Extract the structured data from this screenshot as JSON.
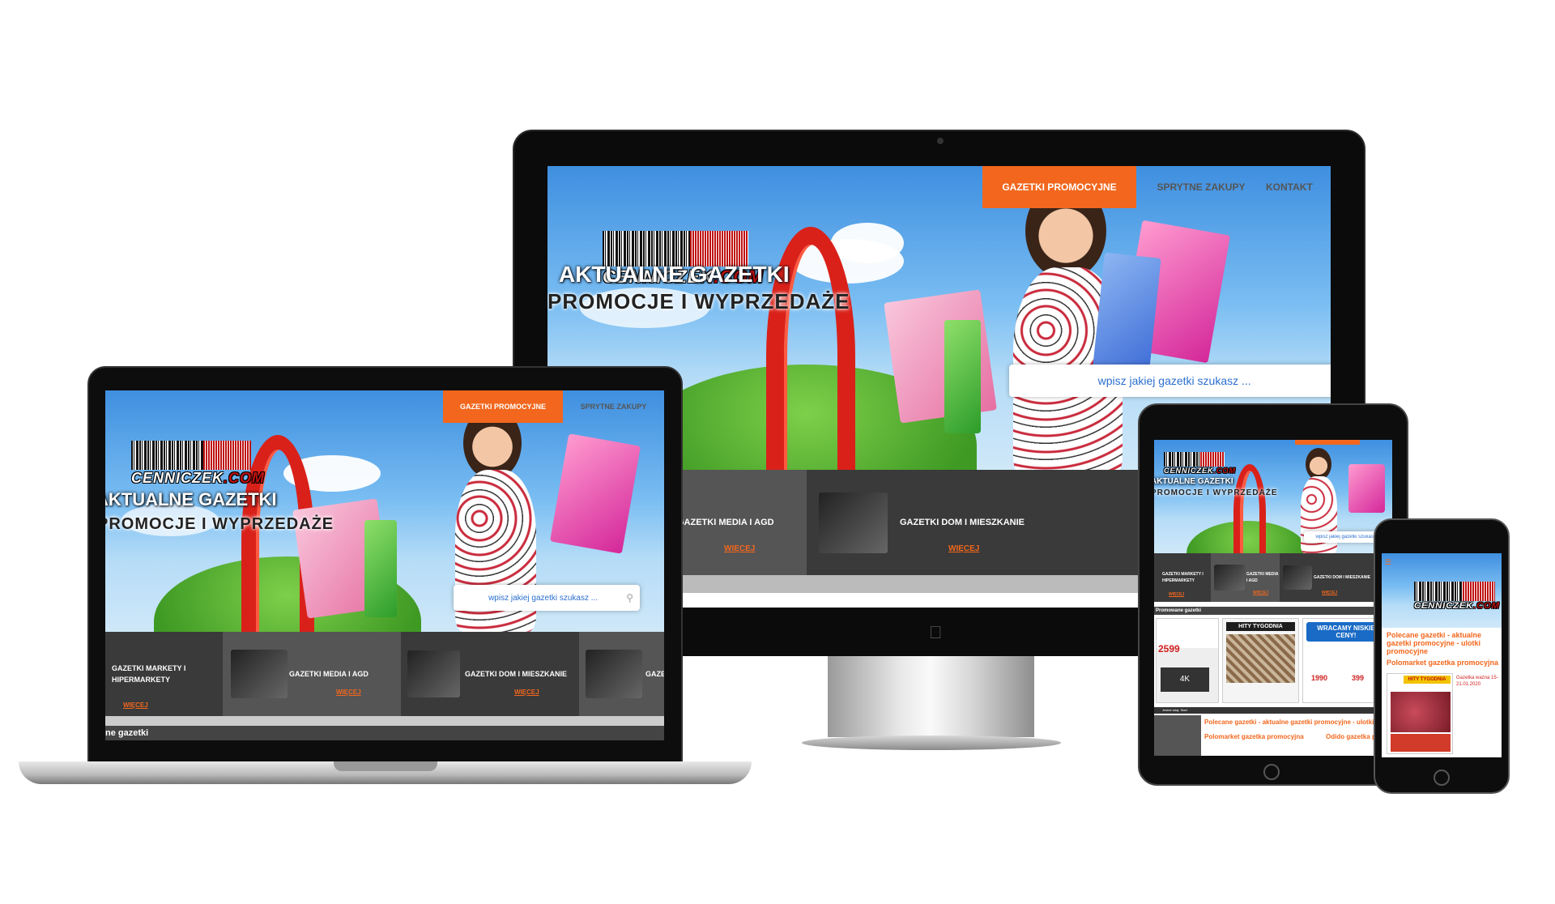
{
  "site": {
    "logo_brand": "CENNICZEK",
    "logo_tld": ".COM",
    "headline": "AKTUALNE GAZETKI",
    "subheadline": "PROMOCJE I WYPRZEDAŻE",
    "search_placeholder": "wpisz jakiej gazetki szukasz ...",
    "nav": [
      "GAZETKI PROMOCYJNE",
      "SPRYTNE ZAKUPY",
      "KONTAKT"
    ],
    "categories": [
      {
        "label": "GAZETKI MARKETY I HIPERMARKETY",
        "more": "Więcej",
        "icon": "shopping-bags-icon"
      },
      {
        "label": "GAZETKI MEDIA I AGD",
        "more": "Więcej",
        "icon": "tv-appliances-icon"
      },
      {
        "label": "GAZETKI DOM I MIESZKANIE",
        "more": "Więcej",
        "icon": "drill-tools-icon"
      },
      {
        "label": "GAZETKI SPORT",
        "more": "Więcej",
        "icon": "bike-sport-icon"
      }
    ],
    "section_title": "Promowane gazetki",
    "laptop_section_title": "ne gazetki",
    "tablet_section_title": "Promowane gazetki",
    "recommended": "Polecane gazetki - aktualne gazetki promocyjne - ulotki promocyjne",
    "flyer_titles": [
      "Polomarket gazetka promocyjna",
      "Odido gazetka promocyjna"
    ],
    "flyer_texts": [
      "HITY TYGODNIA",
      "WRACAMY NISKIE CENY!",
      "2599",
      "4K",
      "1990",
      "399"
    ],
    "flyer_caption": "Gazetka ważna 15-21.01.2020",
    "breadcrumb": "Jesteś tutaj: Start"
  },
  "colors": {
    "accent": "#f2671d",
    "sky_top": "#3f8fe0",
    "dark_band": "#3a3a3a",
    "logo_red": "#c01010"
  },
  "devices": [
    "imac",
    "macbook",
    "ipad",
    "iphone"
  ]
}
